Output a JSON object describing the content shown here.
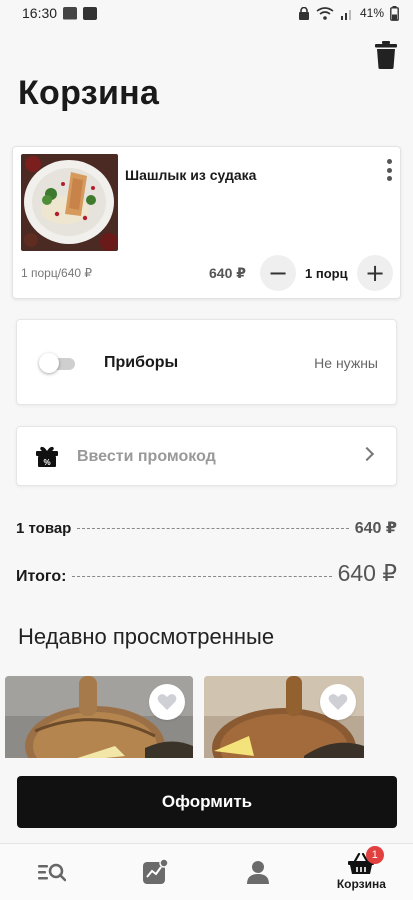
{
  "status_bar": {
    "time": "16:30",
    "battery": "41%"
  },
  "page": {
    "title": "Корзина"
  },
  "cart_item": {
    "name": "Шашлык из судака",
    "portion_info": "1 порц/640 ₽",
    "price": "640 ₽",
    "quantity": "1 порц",
    "minus": "−",
    "plus": "+"
  },
  "cutlery": {
    "label": "Приборы",
    "value": "Не нужны",
    "enabled": false
  },
  "promo": {
    "label": "Ввести промокод"
  },
  "summary": {
    "items_label": "1 товар",
    "items_value": "640 ₽",
    "total_label": "Итого:",
    "total_value": "640 ₽"
  },
  "recent": {
    "title": "Недавно просмотренные"
  },
  "checkout": {
    "label": "Оформить"
  },
  "nav": {
    "items": [
      {
        "icon": "menu-search-icon",
        "label": ""
      },
      {
        "icon": "promo-chart-icon",
        "label": ""
      },
      {
        "icon": "profile-icon",
        "label": ""
      },
      {
        "icon": "basket-icon",
        "label": "Корзина",
        "badge": "1"
      }
    ]
  },
  "colors": {
    "accent": "#111111",
    "badge": "#e2403f",
    "background": "#f7f7f7"
  }
}
